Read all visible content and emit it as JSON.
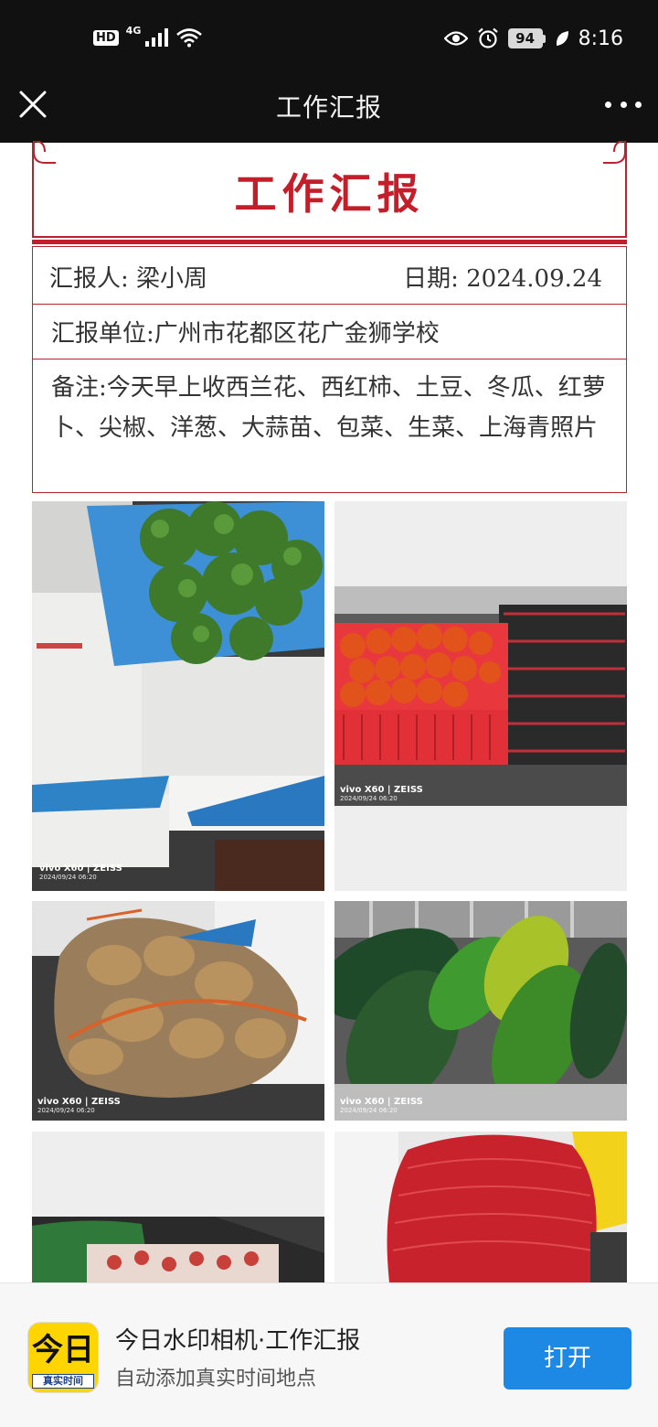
{
  "status_bar": {
    "hd_label": "HD",
    "network_label": "4G",
    "battery_level": "94",
    "time": "8:16",
    "icons": [
      "signal-icon",
      "wifi-icon",
      "eye-icon",
      "alarm-icon",
      "battery-icon",
      "leaf-icon"
    ]
  },
  "nav": {
    "title": "工作汇报",
    "close_icon": "close-icon",
    "more_icon": "more-dots-icon"
  },
  "report": {
    "title": "工作汇报",
    "reporter_label": "汇报人:",
    "reporter_name": "梁小周",
    "date_label": "日期:",
    "date_value": "2024.09.24",
    "unit_line": "汇报单位:广州市花都区花广金狮学校",
    "notes_line": "备注:今天早上收西兰花、西红柿、土豆、冬瓜、红萝卜、尖椒、洋葱、大蒜苗、包菜、生菜、上海青照片",
    "accent_color": "#c41e2a"
  },
  "photos": [
    {
      "subject": "broccoli",
      "watermark_model": "vivo X60 | ZEISS",
      "watermark_time": "2024/09/24 06:20"
    },
    {
      "subject": "tomatoes",
      "watermark_model": "vivo X60 | ZEISS",
      "watermark_time": "2024/09/24 06:20"
    },
    {
      "subject": "potatoes",
      "watermark_model": "vivo X60 | ZEISS",
      "watermark_time": "2024/09/24 06:20"
    },
    {
      "subject": "winter-melons",
      "watermark_model": "vivo X60 | ZEISS",
      "watermark_time": "2024/09/24 06:20"
    },
    {
      "subject": "carrots"
    },
    {
      "subject": "onions"
    }
  ],
  "banner": {
    "app_icon_text": "今日",
    "app_icon_caption": "真实时间",
    "app_name": "今日水印相机·工作汇报",
    "app_subtitle": "自动添加真实时间地点",
    "open_button": "打开",
    "button_color": "#1e88e5"
  }
}
